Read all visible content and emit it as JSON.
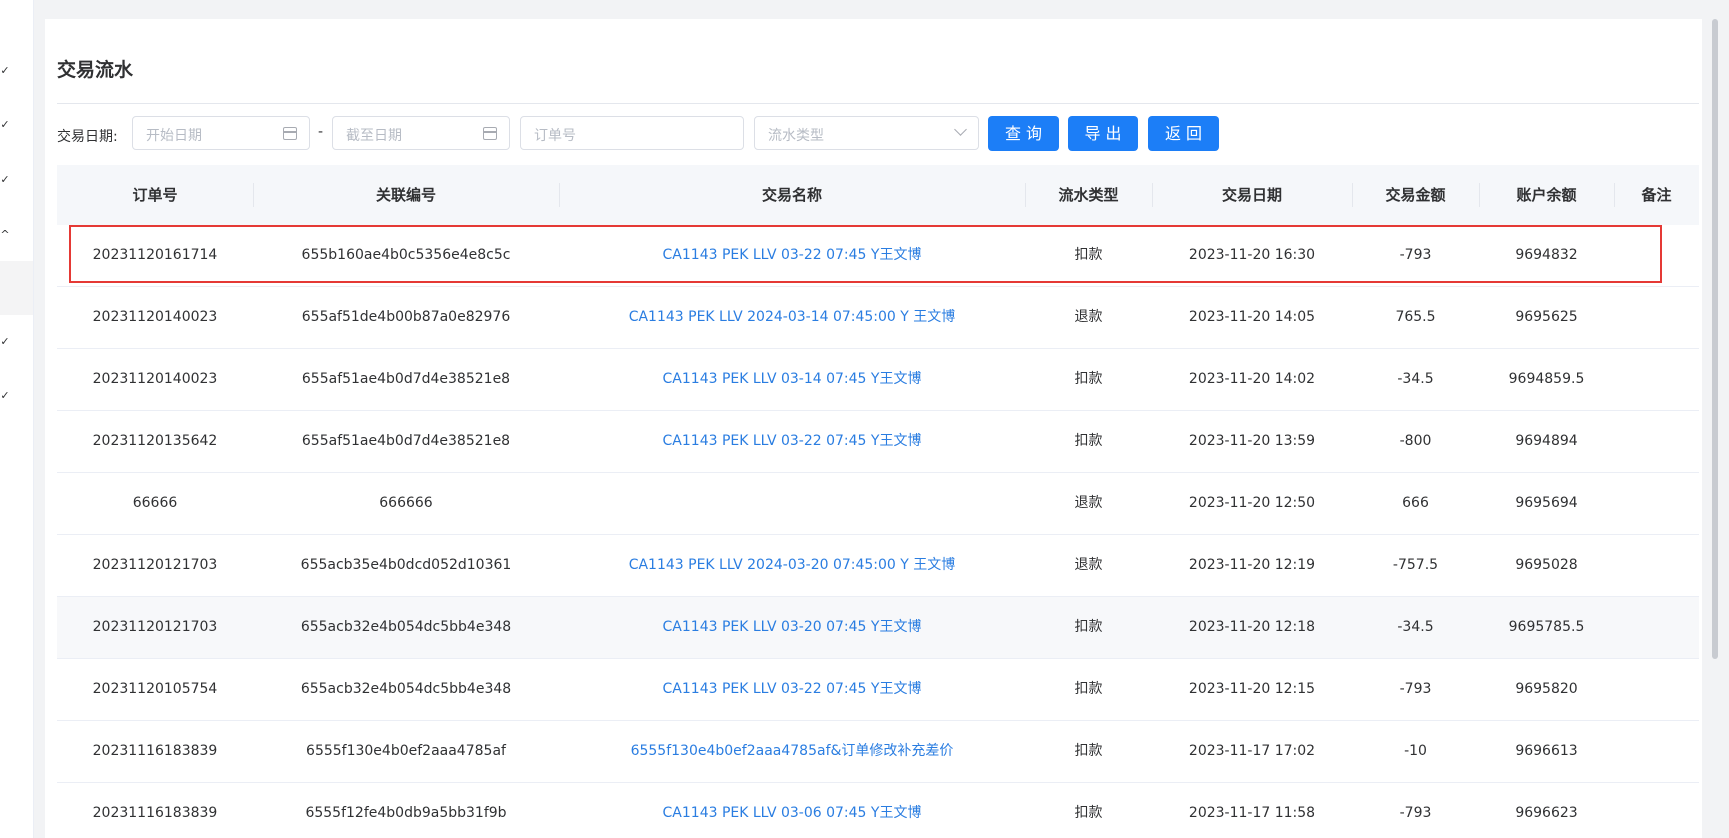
{
  "page": {
    "title": "交易流水"
  },
  "filters": {
    "date_label": "交易日期:",
    "start_placeholder": "开始日期",
    "separator": "-",
    "end_placeholder": "截至日期",
    "order_placeholder": "订单号",
    "type_placeholder": "流水类型",
    "buttons": {
      "query": "查 询",
      "export": "导 出",
      "back": "返 回"
    }
  },
  "table": {
    "headers": [
      "订单号",
      "关联编号",
      "交易名称",
      "流水类型",
      "交易日期",
      "交易金额",
      "账户余额",
      "备注"
    ],
    "rows": [
      [
        "20231120161714",
        "655b160ae4b0c5356e4e8c5c",
        "CA1143 PEK LLV 03-22 07:45 Y王文博",
        "扣款",
        "2023-11-20 16:30",
        "-793",
        "9694832",
        ""
      ],
      [
        "20231120140023",
        "655af51de4b00b87a0e82976",
        "CA1143 PEK LLV 2024-03-14 07:45:00 Y 王文博",
        "退款",
        "2023-11-20 14:05",
        "765.5",
        "9695625",
        ""
      ],
      [
        "20231120140023",
        "655af51ae4b0d7d4e38521e8",
        "CA1143 PEK LLV 03-14 07:45 Y王文博",
        "扣款",
        "2023-11-20 14:02",
        "-34.5",
        "9694859.5",
        ""
      ],
      [
        "20231120135642",
        "655af51ae4b0d7d4e38521e8",
        "CA1143 PEK LLV 03-22 07:45 Y王文博",
        "扣款",
        "2023-11-20 13:59",
        "-800",
        "9694894",
        ""
      ],
      [
        "66666",
        "666666",
        "",
        "退款",
        "2023-11-20 12:50",
        "666",
        "9695694",
        ""
      ],
      [
        "20231120121703",
        "655acb35e4b0dcd052d10361",
        "CA1143 PEK LLV 2024-03-20 07:45:00 Y 王文博",
        "退款",
        "2023-11-20 12:19",
        "-757.5",
        "9695028",
        ""
      ],
      [
        "20231120121703",
        "655acb32e4b054dc5bb4e348",
        "CA1143 PEK LLV 03-20 07:45 Y王文博",
        "扣款",
        "2023-11-20 12:18",
        "-34.5",
        "9695785.5",
        ""
      ],
      [
        "20231120105754",
        "655acb32e4b054dc5bb4e348",
        "CA1143 PEK LLV 03-22 07:45 Y王文博",
        "扣款",
        "2023-11-20 12:15",
        "-793",
        "9695820",
        ""
      ],
      [
        "20231116183839",
        "6555f130e4b0ef2aaa4785af",
        "6555f130e4b0ef2aaa4785af&订单修改补充差价",
        "扣款",
        "2023-11-17 17:02",
        "-10",
        "9696613",
        ""
      ],
      [
        "20231116183839",
        "6555f12fe4b0db9a5bb31f9b",
        "CA1143 PEK LLV 03-06 07:45 Y王文博",
        "扣款",
        "2023-11-17 11:58",
        "-793",
        "9696623",
        ""
      ]
    ]
  },
  "colors": {
    "primary": "#1c7ef7",
    "link": "#2a7de1",
    "highlight": "#e53935"
  }
}
